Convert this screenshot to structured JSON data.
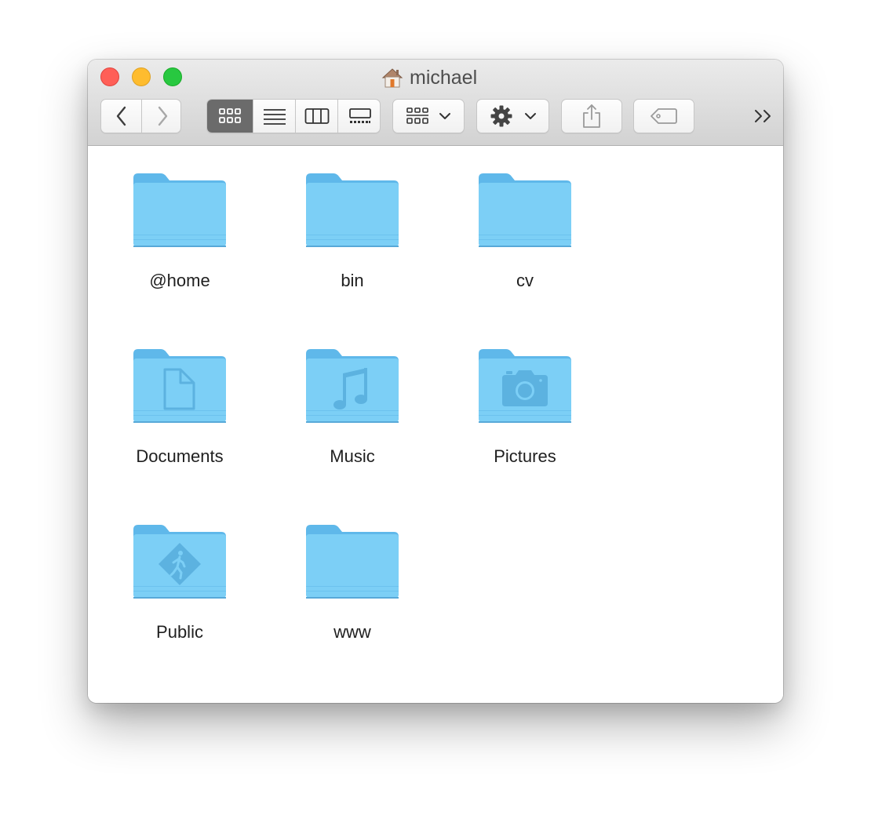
{
  "window": {
    "title": "michael",
    "title_icon": "home-icon"
  },
  "toolbar": {
    "back_icon": "chevron-left-icon",
    "forward_icon": "chevron-right-icon",
    "view_modes": [
      {
        "name": "icon-view",
        "icon": "grid-icon",
        "active": true
      },
      {
        "name": "list-view",
        "icon": "list-icon",
        "active": false
      },
      {
        "name": "column-view",
        "icon": "columns-icon",
        "active": false
      },
      {
        "name": "gallery-view",
        "icon": "gallery-icon",
        "active": false
      }
    ],
    "group_icon": "group-grid-icon",
    "action_icon": "gear-icon",
    "share_icon": "share-icon",
    "tag_icon": "tag-icon",
    "overflow_icon": "double-chevron-right-icon"
  },
  "folders": [
    {
      "name": "@home",
      "badge": "none"
    },
    {
      "name": "bin",
      "badge": "none"
    },
    {
      "name": "cv",
      "badge": "none"
    },
    {
      "name": "Documents",
      "badge": "document-icon"
    },
    {
      "name": "Music",
      "badge": "music-note-icon"
    },
    {
      "name": "Pictures",
      "badge": "camera-icon"
    },
    {
      "name": "Public",
      "badge": "public-walker-icon"
    },
    {
      "name": "www",
      "badge": "none"
    }
  ],
  "colors": {
    "folder_front": "#7ccff6",
    "folder_back": "#5fb8ea",
    "active_segment": "#6b6b6b",
    "close": "#ff5f57",
    "minimize": "#febc2e",
    "maximize": "#28c840"
  }
}
